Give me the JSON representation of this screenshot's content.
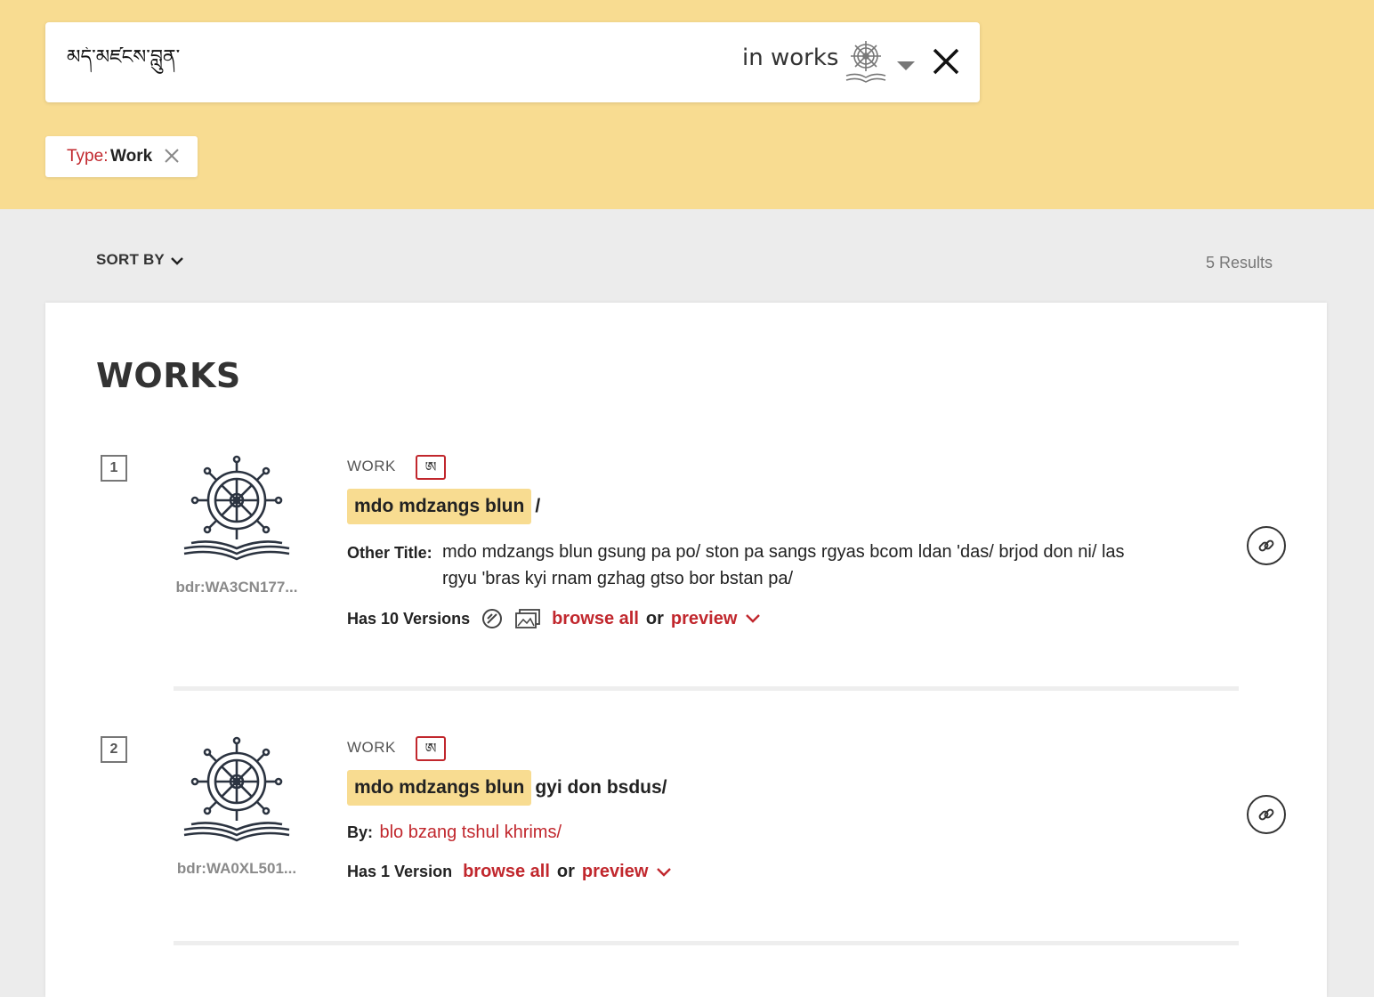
{
  "search": {
    "query": "མདོ་མཛངས་བླུན་",
    "scope_label": "in works",
    "scope_icon": "dharma-wheel-icon",
    "clear_icon": "close-icon"
  },
  "filters": [
    {
      "key": "Type:",
      "value": "Work",
      "remove_icon": "close-icon"
    }
  ],
  "toolbar": {
    "sort_label": "SORT BY",
    "results_count": "5 Results"
  },
  "section": {
    "title": "WORKS"
  },
  "colors": {
    "accent": "#c1272d",
    "highlight": "#f8dc91",
    "band": "#f8dc91",
    "background": "#ececec"
  },
  "results": [
    {
      "index": "1",
      "id": "bdr:WA3CN177...",
      "type_label": "WORK",
      "script_badge": "ཨ",
      "title_highlight": "mdo mdzangs blun",
      "title_rest": "/",
      "other_title_label": "Other Title:",
      "other_title": "mdo mdzangs blun gsung pa po/ ston pa sangs rgyas bcom ldan 'das/ brjod don ni/ las rgyu 'bras kyi rnam gzhag gtso bor bstan pa/",
      "versions_text": "Has 10 Versions",
      "browse_label": "browse all",
      "or_label": "or",
      "preview_label": "preview"
    },
    {
      "index": "2",
      "id": "bdr:WA0XL501...",
      "type_label": "WORK",
      "script_badge": "ཨ",
      "title_highlight": "mdo mdzangs blun",
      "title_rest": "gyi don bsdus/",
      "by_label": "By:",
      "by_value": "blo bzang tshul khrims/",
      "versions_text": "Has 1 Version",
      "browse_label": "browse all",
      "or_label": "or",
      "preview_label": "preview"
    }
  ]
}
